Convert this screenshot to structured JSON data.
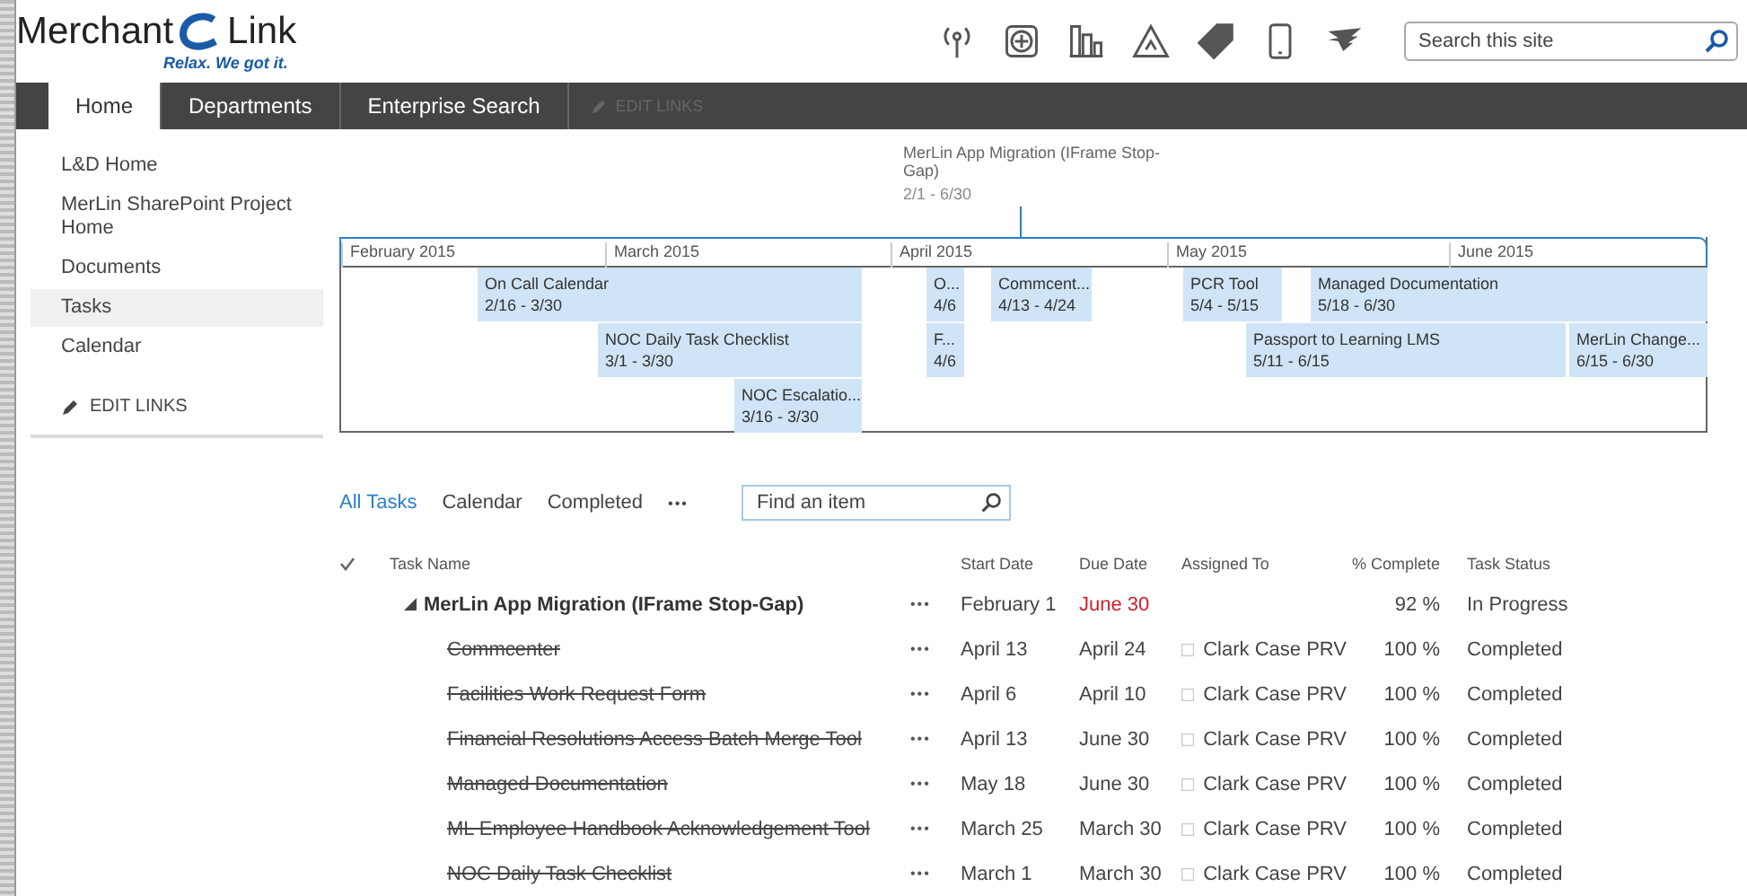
{
  "logo": {
    "name_left": "Merchant",
    "name_right": "Link",
    "tagline": "Relax. We got it."
  },
  "search": {
    "placeholder": "Search this site"
  },
  "nav": {
    "tabs": [
      {
        "label": "Home",
        "selected": true
      },
      {
        "label": "Departments",
        "selected": false
      },
      {
        "label": "Enterprise Search",
        "selected": false
      }
    ],
    "edit_links": {
      "label": "EDIT LINKS",
      "disabled": true
    }
  },
  "sidebar": {
    "items": [
      {
        "label": "L&D Home",
        "selected": false
      },
      {
        "label": "MerLin SharePoint Project Home",
        "selected": false
      },
      {
        "label": "Documents",
        "selected": false
      },
      {
        "label": "Tasks",
        "selected": true
      },
      {
        "label": "Calendar",
        "selected": false
      }
    ],
    "edit_links": "EDIT LINKS"
  },
  "timeline": {
    "summary": {
      "title": "MerLin App Migration (IFrame Stop-Gap)",
      "dates": "2/1 - 6/30"
    },
    "months": [
      "February 2015",
      "March 2015",
      "April 2015",
      "May 2015",
      "June 2015"
    ],
    "bars": [
      {
        "name": "On Call Calendar",
        "dates": "2/16 - 3/30"
      },
      {
        "name": "O...",
        "dates": "4/6"
      },
      {
        "name": "Commcent...",
        "dates": "4/13 - 4/24"
      },
      {
        "name": "PCR Tool",
        "dates": "5/4 - 5/15"
      },
      {
        "name": "Managed Documentation",
        "dates": "5/18 - 6/30"
      },
      {
        "name": "NOC Daily Task Checklist",
        "dates": "3/1 - 3/30"
      },
      {
        "name": "F...",
        "dates": "4/6"
      },
      {
        "name": "Passport to Learning LMS",
        "dates": "5/11 - 6/15"
      },
      {
        "name": "MerLin Change...",
        "dates": "6/15 - 6/30"
      },
      {
        "name": "NOC Escalatio...",
        "dates": "3/16 - 3/30"
      }
    ]
  },
  "views": {
    "tabs": [
      {
        "label": "All Tasks",
        "selected": true
      },
      {
        "label": "Calendar",
        "selected": false
      },
      {
        "label": "Completed",
        "selected": false
      }
    ],
    "more": "•••",
    "search_placeholder": "Find an item"
  },
  "table": {
    "columns": [
      "Task Name",
      "Start Date",
      "Due Date",
      "Assigned To",
      "% Complete",
      "Task Status"
    ],
    "rows": [
      {
        "kind": "parent",
        "name": "MerLin App Migration (IFrame Stop-Gap)",
        "expanded": true,
        "completed": false,
        "more": "•••",
        "start": "February 1",
        "due": "June 30",
        "overdue": true,
        "assigned": "",
        "percent": "92 %",
        "status": "In Progress"
      },
      {
        "kind": "child",
        "name": "Commcenter",
        "completed": true,
        "more": "•••",
        "start": "April 13",
        "due": "April 24",
        "overdue": false,
        "assigned": "Clark Case PRV",
        "percent": "100 %",
        "status": "Completed"
      },
      {
        "kind": "child",
        "name": "Facilities Work Request Form",
        "completed": true,
        "more": "•••",
        "start": "April 6",
        "due": "April 10",
        "overdue": false,
        "assigned": "Clark Case PRV",
        "percent": "100 %",
        "status": "Completed"
      },
      {
        "kind": "child",
        "name": "Financial Resolutions Access Batch Merge Tool",
        "completed": true,
        "more": "•••",
        "start": "April 13",
        "due": "June 30",
        "overdue": false,
        "assigned": "Clark Case PRV",
        "percent": "100 %",
        "status": "Completed"
      },
      {
        "kind": "child",
        "name": "Managed Documentation",
        "completed": true,
        "more": "•••",
        "start": "May 18",
        "due": "June 30",
        "overdue": false,
        "assigned": "Clark Case PRV",
        "percent": "100 %",
        "status": "Completed"
      },
      {
        "kind": "child",
        "name": "ML Employee Handbook Acknowledgement Tool",
        "completed": true,
        "more": "•••",
        "start": "March 25",
        "due": "March 30",
        "overdue": false,
        "assigned": "Clark Case PRV",
        "percent": "100 %",
        "status": "Completed"
      },
      {
        "kind": "child",
        "name": "NOC Daily Task Checklist",
        "completed": true,
        "more": "•••",
        "start": "March 1",
        "due": "March 30",
        "overdue": false,
        "assigned": "Clark Case PRV",
        "percent": "100 %",
        "status": "Completed"
      }
    ]
  }
}
